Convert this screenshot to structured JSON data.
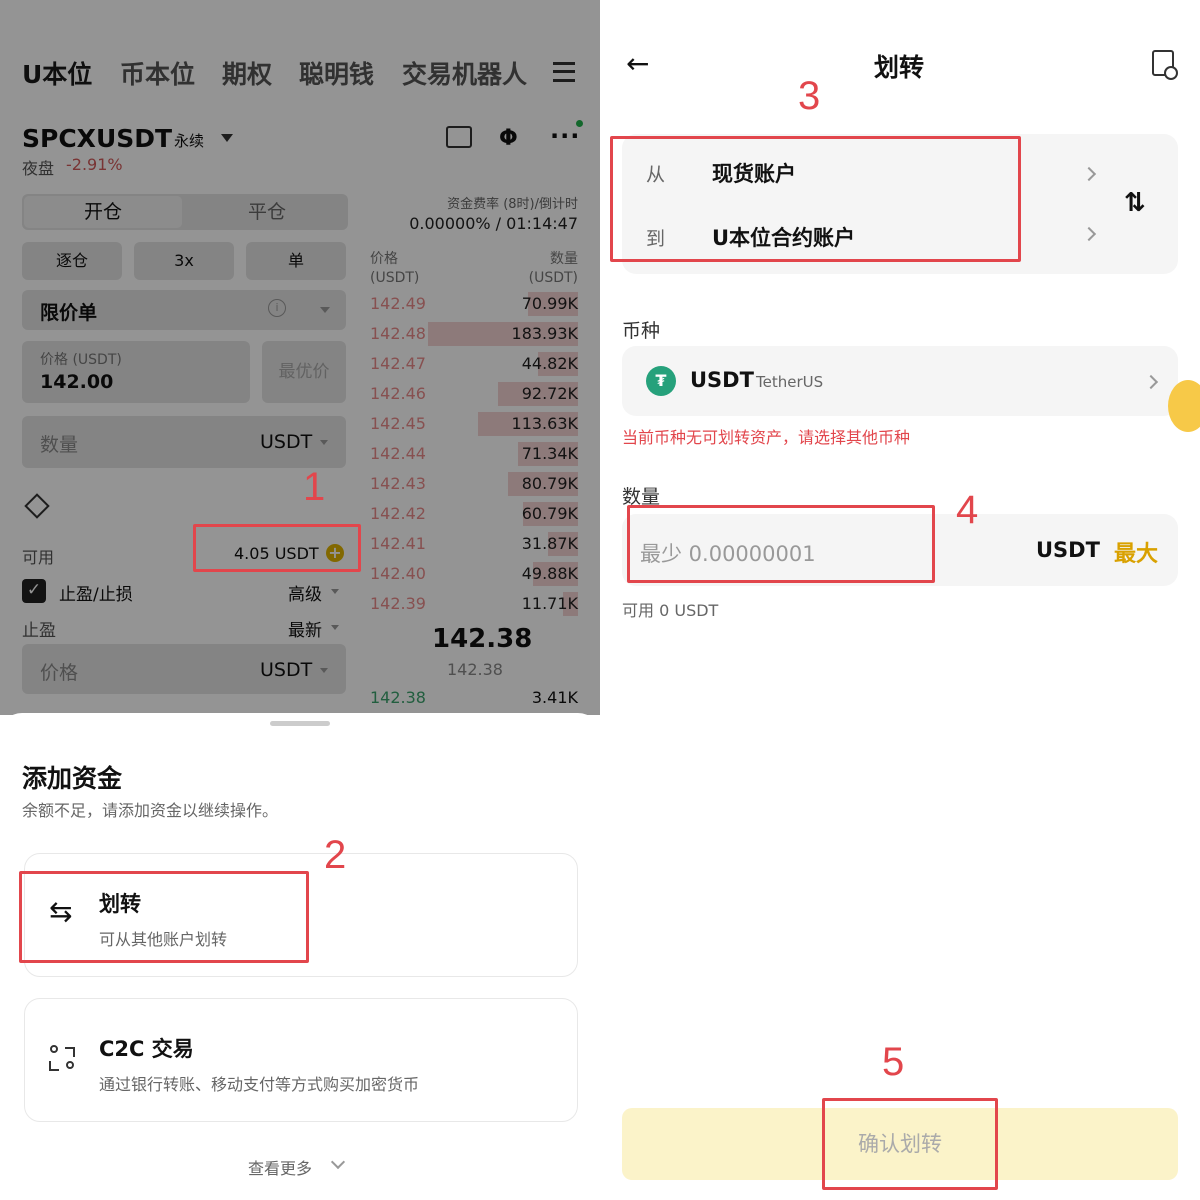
{
  "left": {
    "tabs": [
      "U本位",
      "币本位",
      "期权",
      "聪明钱",
      "交易机器人"
    ],
    "pair": "SPCXUSDT",
    "pair_tag": "永续",
    "session": "夜盘",
    "change": "-2.91%",
    "open_tab": "开仓",
    "close_tab": "平仓",
    "funding_label": "资金费率 (8时)/倒计时",
    "funding_value": "0.00000% / 01:14:47",
    "margin_mode": "逐仓",
    "leverage": "3x",
    "position_mode": "单",
    "order_type": "限价单",
    "price_label": "价格 (USDT)",
    "price_value": "142.00",
    "best_price": "最优价",
    "qty_label": "数量",
    "qty_unit": "USDT",
    "available_label": "可用",
    "available_value": "4.05 USDT",
    "tpsl_label": "止盈/止损",
    "advanced": "高级",
    "sl_label": "止盈",
    "latest": "最新",
    "sl_price_ph": "价格",
    "sl_unit": "USDT",
    "ob_header_price": "价格",
    "ob_header_price_unit": "(USDT)",
    "ob_header_qty": "数量",
    "ob_header_qty_unit": "(USDT)",
    "orderbook": [
      {
        "price": "142.49",
        "qty": "70.99K"
      },
      {
        "price": "142.48",
        "qty": "183.93K"
      },
      {
        "price": "142.47",
        "qty": "44.82K"
      },
      {
        "price": "142.46",
        "qty": "92.72K"
      },
      {
        "price": "142.45",
        "qty": "113.63K"
      },
      {
        "price": "142.44",
        "qty": "71.34K"
      },
      {
        "price": "142.43",
        "qty": "80.79K"
      },
      {
        "price": "142.42",
        "qty": "60.79K"
      },
      {
        "price": "142.41",
        "qty": "31.87K"
      },
      {
        "price": "142.40",
        "qty": "49.88K"
      },
      {
        "price": "142.39",
        "qty": "11.71K"
      }
    ],
    "last_price": "142.38",
    "mark_price": "142.38",
    "bid_price": "142.38",
    "bid_qty": "3.41K"
  },
  "sheet": {
    "title": "添加资金",
    "subtitle": "余额不足，请添加资金以继续操作。",
    "transfer_title": "划转",
    "transfer_desc": "可从其他账户划转",
    "c2c_title": "C2C 交易",
    "c2c_desc": "通过银行转账、移动支付等方式购买加密货币",
    "more": "查看更多"
  },
  "right": {
    "title": "划转",
    "from_label": "从",
    "from_value": "现货账户",
    "to_label": "到",
    "to_value": "U本位合约账户",
    "coin_label": "币种",
    "coin_symbol": "USDT",
    "coin_name": "TetherUS",
    "coin_warning": "当前币种无可划转资产，请选择其他币种",
    "amount_label": "数量",
    "amount_placeholder": "最少 0.00000001",
    "amount_unit": "USDT",
    "max": "最大",
    "available": "可用 0 USDT",
    "confirm": "确认划转"
  },
  "annotations": [
    "1",
    "2",
    "3",
    "4",
    "5"
  ],
  "colors": {
    "annotation_red": "#e2464c",
    "accent_yellow": "#d9a100",
    "confirm_bg": "#fbf3c9",
    "warning_red": "#e2464c",
    "sell_red": "#e88b8b",
    "tether_green": "#26a17b"
  }
}
